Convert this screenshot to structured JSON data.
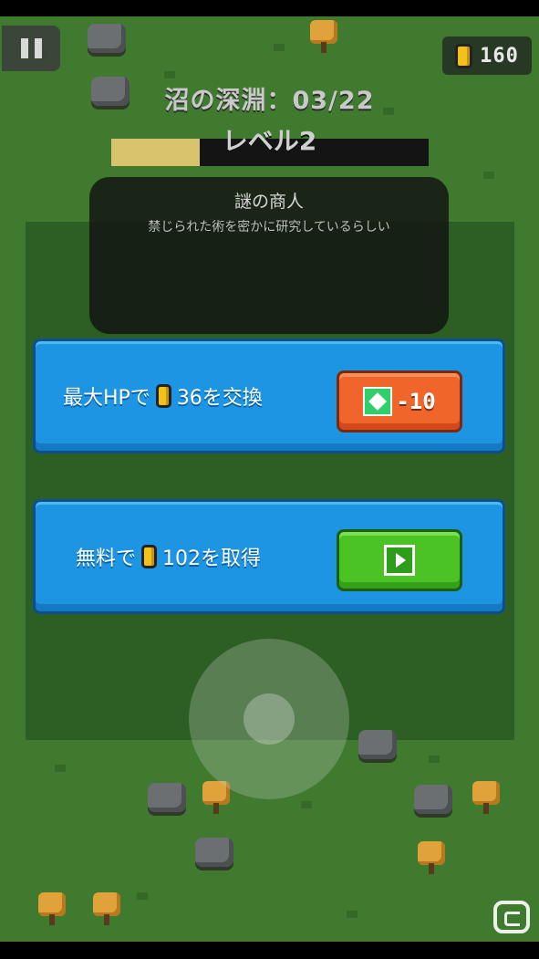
{
  "hud": {
    "coins": "160",
    "stage_title": "沼の深淵：03/22",
    "level_label": "レベル2",
    "level_progress": 0.28
  },
  "merchant": {
    "name": "謎の商人",
    "description": "禁じられた術を密かに研究しているらしい"
  },
  "offers": [
    {
      "prefix": "最大HPで",
      "amount": "36を交換",
      "button_text": "-10",
      "button_icon": "heart-health-icon"
    },
    {
      "prefix": "無料で",
      "amount": "102を取得",
      "button_icon": "video-ad-play-icon"
    }
  ],
  "colors": {
    "offer_card": "#1d95e3",
    "trade_button": "#f0652a",
    "ad_button": "#4cc325",
    "coin": "#f2c21b"
  }
}
